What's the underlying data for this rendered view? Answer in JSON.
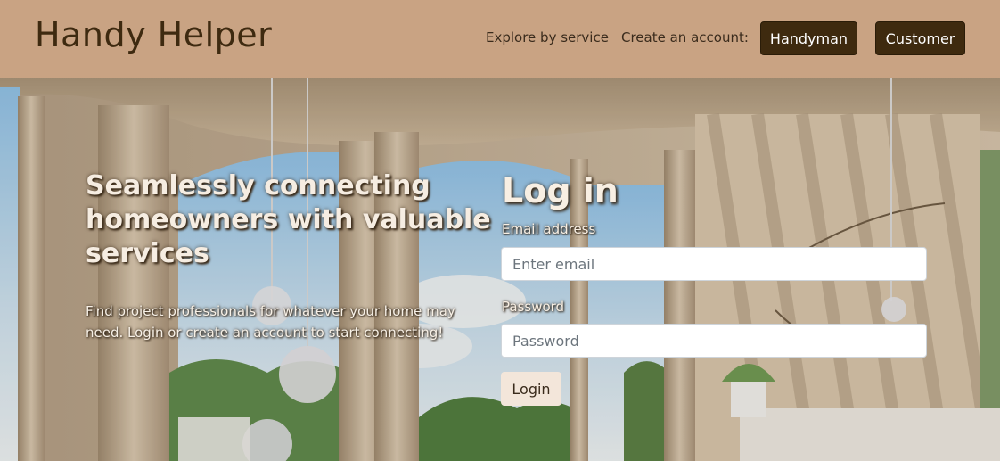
{
  "navbar": {
    "brand": "Handy Helper",
    "explore_link": "Explore by service",
    "create_label": "Create an account:",
    "handyman_button": "Handyman",
    "customer_button": "Customer"
  },
  "hero": {
    "headline": "Seamlessly connecting homeowners with valuable services",
    "subtext": "Find project professionals for whatever your home may need. Login or create an account to start connecting!"
  },
  "login": {
    "title": "Log in",
    "email_label": "Email address",
    "email_placeholder": "Enter email",
    "email_value": "",
    "password_label": "Password",
    "password_placeholder": "Password",
    "password_value": "",
    "submit_label": "Login"
  },
  "colors": {
    "navbar_bg": "#c9a383",
    "brand_text": "#3e2a10",
    "dark_button": "#3e2a0f",
    "login_button": "#f3e6da"
  }
}
